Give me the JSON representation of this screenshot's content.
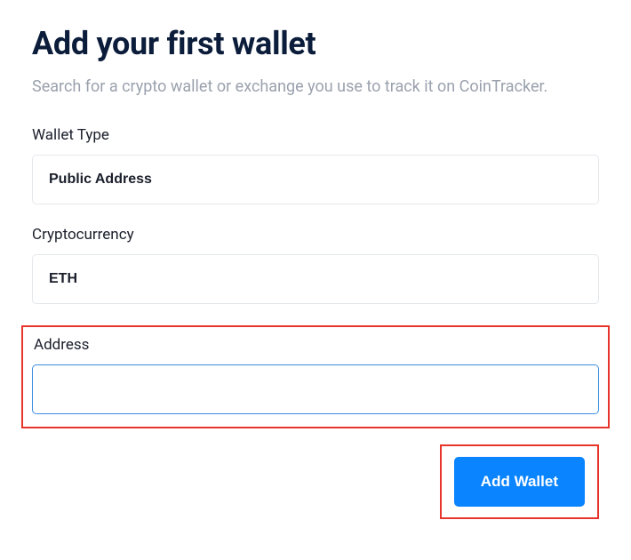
{
  "header": {
    "title": "Add your first wallet",
    "subtitle": "Search for a crypto wallet or exchange you use to track it on CoinTracker."
  },
  "form": {
    "wallet_type": {
      "label": "Wallet Type",
      "value": "Public Address"
    },
    "cryptocurrency": {
      "label": "Cryptocurrency",
      "value": "ETH"
    },
    "address": {
      "label": "Address",
      "value": ""
    }
  },
  "actions": {
    "submit_label": "Add Wallet"
  }
}
